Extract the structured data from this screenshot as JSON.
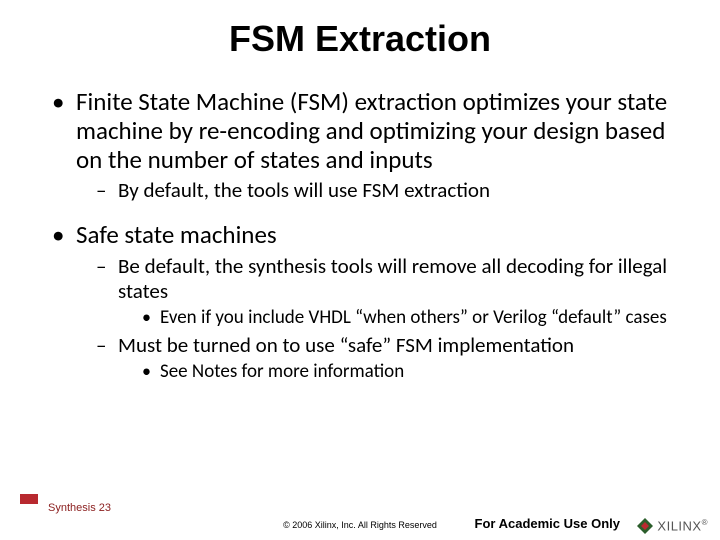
{
  "title": "FSM Extraction",
  "bullets": {
    "b1": "Finite State Machine (FSM) extraction optimizes your state machine by\nre-encoding and optimizing your design based on the number of states and inputs",
    "b1_1": "By default, the tools will use FSM extraction",
    "b2": "Safe state machines",
    "b2_1": "Be default, the synthesis tools will remove all decoding for illegal states",
    "b2_1_1": "Even if you include VHDL “when others” or Verilog “default” cases",
    "b2_2": "Must be turned on to use “safe” FSM implementation",
    "b2_2_1": "See Notes for more information"
  },
  "footer": {
    "label": "Synthesis  23",
    "copyright": "© 2006 Xilinx, Inc. All Rights Reserved",
    "academic": "For Academic Use Only",
    "logo": "XILINX",
    "reg": "®"
  }
}
